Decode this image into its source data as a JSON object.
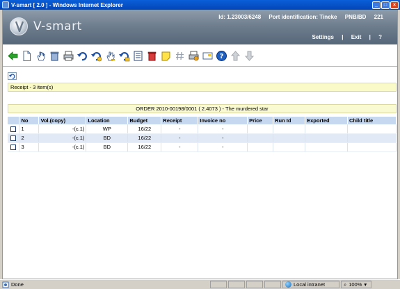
{
  "window": {
    "title": "V-smart [ 2.0 ] - Windows Internet Explorer",
    "buttons": {
      "minimize": "_",
      "maximize": "□",
      "close": "×"
    }
  },
  "header": {
    "brand": "V-smart",
    "id_label": "Id: 1.23003/6248",
    "port_label": "Port identification: Tineke",
    "location": "PNB/BD",
    "terminal": "221",
    "links": {
      "settings": "Settings",
      "exit": "Exit",
      "help": "?"
    }
  },
  "toolbar": {
    "icons": [
      "back-arrow-icon",
      "new-document-icon",
      "hand-select-icon",
      "delete-bin-icon",
      "print-icon",
      "undo-icon",
      "undo-to-icon",
      "hand-undo-icon",
      "undo-other-icon",
      "list-icon",
      "red-delete-bin-icon",
      "note-icon",
      "hash-icon",
      "printer-settings-icon",
      "card-icon",
      "help-icon",
      "move-up-icon",
      "move-down-icon"
    ]
  },
  "summary": {
    "text": "Receipt - 3 item(s)"
  },
  "order": {
    "text": "ORDER 2010-00198/0001 ( 2.4073 ) - The murdered star"
  },
  "table": {
    "columns": [
      "",
      "No",
      "Vol.(copy)",
      "Location",
      "Budget",
      "Receipt",
      "Invoice no",
      "Price",
      "Run Id",
      "Exported",
      "Child title"
    ],
    "rows": [
      {
        "no": "1",
        "vol": "-(c.1)",
        "location": "WP",
        "budget": "16/22",
        "receipt": "-",
        "invoice": "-",
        "price": "",
        "run_id": "",
        "exported": "",
        "child_title": ""
      },
      {
        "no": "2",
        "vol": "-(c.1)",
        "location": "BD",
        "budget": "16/22",
        "receipt": "-",
        "invoice": "-",
        "price": "",
        "run_id": "",
        "exported": "",
        "child_title": ""
      },
      {
        "no": "3",
        "vol": "-(c.1)",
        "location": "BD",
        "budget": "16/22",
        "receipt": "-",
        "invoice": "-",
        "price": "",
        "run_id": "",
        "exported": "",
        "child_title": ""
      }
    ]
  },
  "status": {
    "left": "Done",
    "zone": "Local intranet",
    "zoom": "100%"
  },
  "colors": {
    "titlebar": "#0a5fd8",
    "header": "#6f7e8e",
    "table_header": "#c6d7f0",
    "row_alt": "#e1e9f6",
    "yellow_bar": "#fafac8"
  }
}
